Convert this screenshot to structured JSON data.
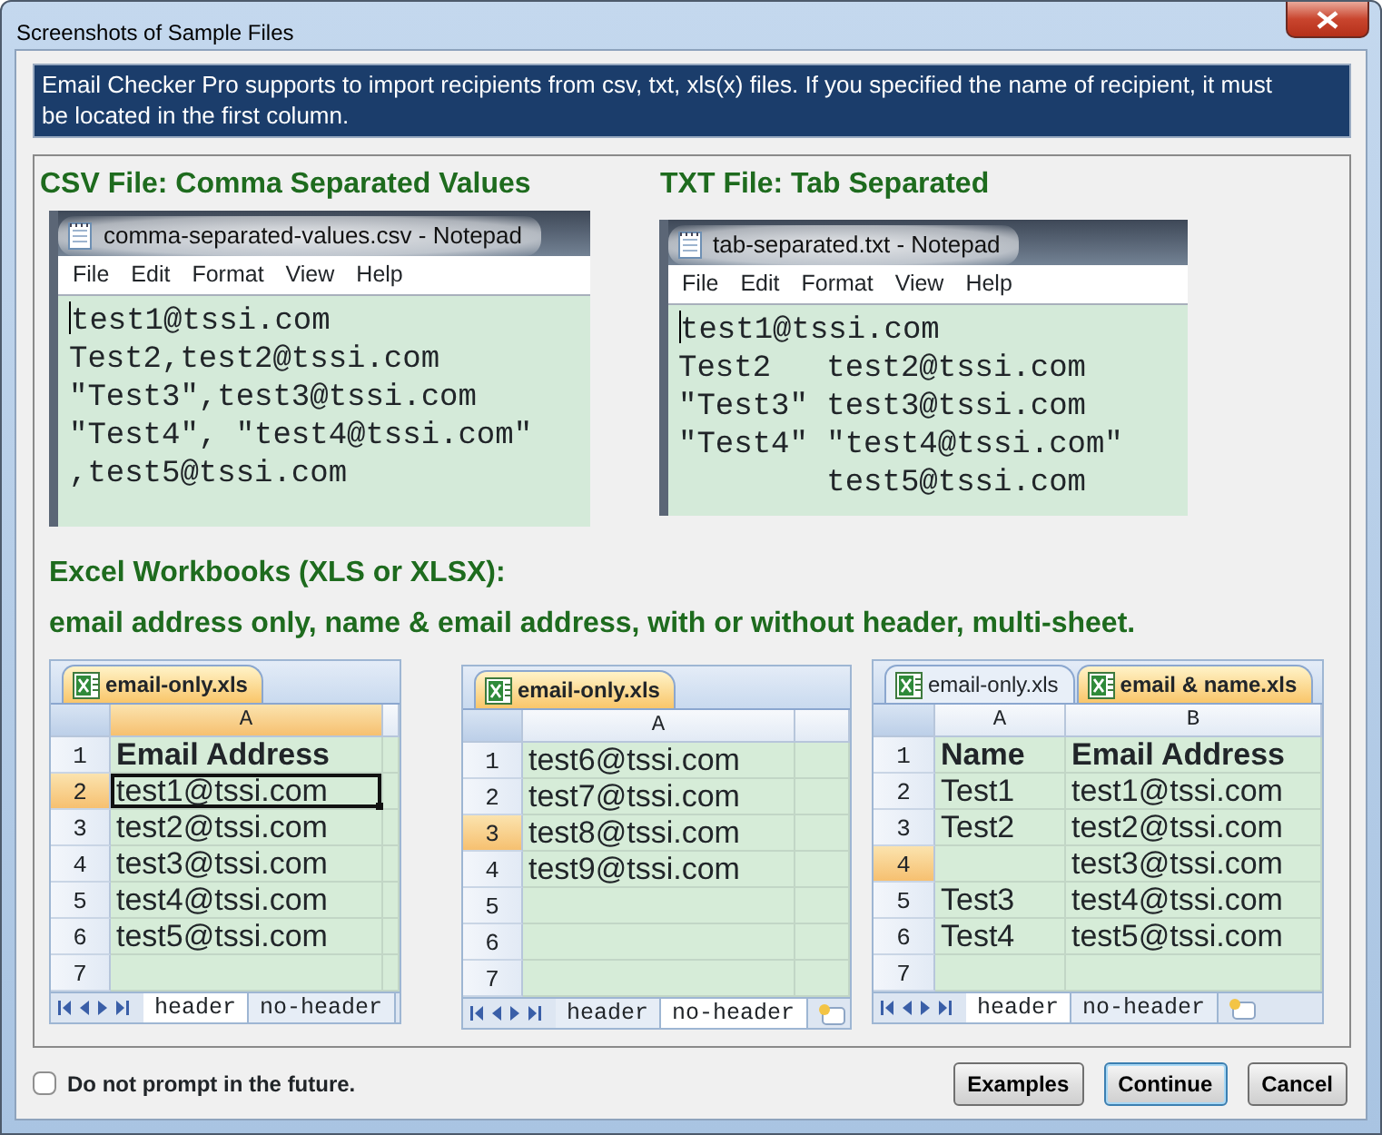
{
  "window": {
    "title": "Screenshots of Sample Files"
  },
  "info": "Email Checker Pro supports to import recipients from csv, txt, xls(x) files. If you specified the name of recipient, it must be located in the first column.",
  "csv": {
    "heading": "CSV File: Comma Separated Values",
    "notepad": {
      "title": "comma-separated-values.csv - Notepad",
      "menu": [
        "File",
        "Edit",
        "Format",
        "View",
        "Help"
      ],
      "caret_at_start": true,
      "lines": [
        "test1@tssi.com",
        "Test2,test2@tssi.com",
        "\"Test3\",test3@tssi.com",
        "\"Test4\", \"test4@tssi.com\"",
        ",test5@tssi.com"
      ]
    }
  },
  "txt": {
    "heading": "TXT File: Tab Separated",
    "notepad": {
      "title": "tab-separated.txt - Notepad",
      "menu": [
        "File",
        "Edit",
        "Format",
        "View",
        "Help"
      ],
      "caret_at_start": true,
      "lines": [
        "test1@tssi.com",
        "Test2\ttest2@tssi.com",
        "\"Test3\"\ttest3@tssi.com",
        "\"Test4\"\t\"test4@tssi.com\"",
        "\ttest5@tssi.com"
      ]
    }
  },
  "excel": {
    "headings": [
      "Excel Workbooks (XLS or XLSX):",
      "email address only, name & email address, with or without header, multi-sheet."
    ],
    "workbooks": [
      {
        "file_tabs": [
          {
            "label": "email-only.xls",
            "selected": true
          }
        ],
        "columns": [
          {
            "label": "A",
            "selected": true
          }
        ],
        "header_row": true,
        "active_cell": true,
        "insert_sheet": false,
        "rows": [
          {
            "number": "1",
            "selected": false,
            "cells": [
              "Email Address"
            ]
          },
          {
            "number": "2",
            "selected": true,
            "cells": [
              "test1@tssi.com"
            ]
          },
          {
            "number": "3",
            "selected": false,
            "cells": [
              "test2@tssi.com"
            ]
          },
          {
            "number": "4",
            "selected": false,
            "cells": [
              "test3@tssi.com"
            ]
          },
          {
            "number": "5",
            "selected": false,
            "cells": [
              "test4@tssi.com"
            ]
          },
          {
            "number": "6",
            "selected": false,
            "cells": [
              "test5@tssi.com"
            ]
          },
          {
            "number": "7",
            "selected": false,
            "cells": []
          }
        ],
        "sheet_tabs": [
          {
            "label": "header",
            "selected": true
          },
          {
            "label": "no-header",
            "selected": false
          }
        ]
      },
      {
        "file_tabs": [
          {
            "label": "email-only.xls",
            "selected": true
          }
        ],
        "columns": [
          {
            "label": "A",
            "selected": false
          }
        ],
        "header_row": false,
        "active_cell": false,
        "insert_sheet": true,
        "rows": [
          {
            "number": "1",
            "selected": false,
            "cells": [
              "test6@tssi.com"
            ]
          },
          {
            "number": "2",
            "selected": false,
            "cells": [
              "test7@tssi.com"
            ]
          },
          {
            "number": "3",
            "selected": true,
            "cells": [
              "test8@tssi.com"
            ]
          },
          {
            "number": "4",
            "selected": false,
            "cells": [
              "test9@tssi.com"
            ]
          },
          {
            "number": "5",
            "selected": false,
            "cells": []
          },
          {
            "number": "6",
            "selected": false,
            "cells": []
          },
          {
            "number": "7",
            "selected": false,
            "cells": []
          }
        ],
        "sheet_tabs": [
          {
            "label": "header",
            "selected": false
          },
          {
            "label": "no-header",
            "selected": true
          }
        ]
      },
      {
        "file_tabs": [
          {
            "label": "email-only.xls",
            "selected": false
          },
          {
            "label": "email & name.xls",
            "selected": true
          }
        ],
        "columns": [
          {
            "label": "A",
            "selected": false
          },
          {
            "label": "B",
            "selected": false
          }
        ],
        "header_row": true,
        "active_cell": false,
        "insert_sheet": true,
        "rows": [
          {
            "number": "1",
            "selected": false,
            "cells": [
              "Name",
              "Email Address"
            ]
          },
          {
            "number": "2",
            "selected": false,
            "cells": [
              "Test1",
              "test1@tssi.com"
            ]
          },
          {
            "number": "3",
            "selected": false,
            "cells": [
              "Test2",
              "test2@tssi.com"
            ]
          },
          {
            "number": "4",
            "selected": true,
            "cells": [
              null,
              "test3@tssi.com"
            ]
          },
          {
            "number": "5",
            "selected": false,
            "cells": [
              "Test3",
              "test4@tssi.com"
            ]
          },
          {
            "number": "6",
            "selected": false,
            "cells": [
              "Test4",
              "test5@tssi.com"
            ]
          },
          {
            "number": "7",
            "selected": false,
            "cells": []
          }
        ],
        "sheet_tabs": [
          {
            "label": "header",
            "selected": true
          },
          {
            "label": "no-header",
            "selected": false
          }
        ]
      }
    ]
  },
  "footer": {
    "checkbox": {
      "label": "Do not prompt in the future.",
      "checked": false
    },
    "buttons": [
      {
        "label": "Examples",
        "default": false
      },
      {
        "label": "Continue",
        "default": true
      },
      {
        "label": "Cancel",
        "default": false
      }
    ]
  }
}
